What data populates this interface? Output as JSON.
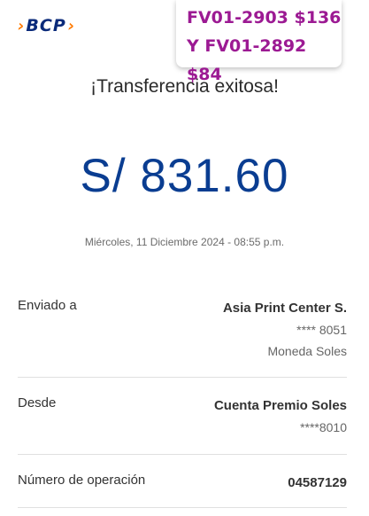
{
  "logo": {
    "chevron_left": "›",
    "brand": "BCP",
    "chevron_right": "›"
  },
  "note": {
    "line1": "FV01-2903  $136",
    "line2": "Y  FV01-2892 $84"
  },
  "receipt": {
    "title": "¡Transferencia exitosa!",
    "amount": "S/ 831.60",
    "datetime": "Miércoles, 11 Diciembre 2024 - 08:55 p.m."
  },
  "details": {
    "sent_to": {
      "label": "Enviado a",
      "name": "Asia Print Center S.",
      "account": "**** 8051",
      "currency": "Moneda Soles"
    },
    "from": {
      "label": "Desde",
      "name": "Cuenta Premio Soles",
      "account": "****8010"
    },
    "operation": {
      "label": "Número de operación",
      "number": "04587129"
    }
  }
}
